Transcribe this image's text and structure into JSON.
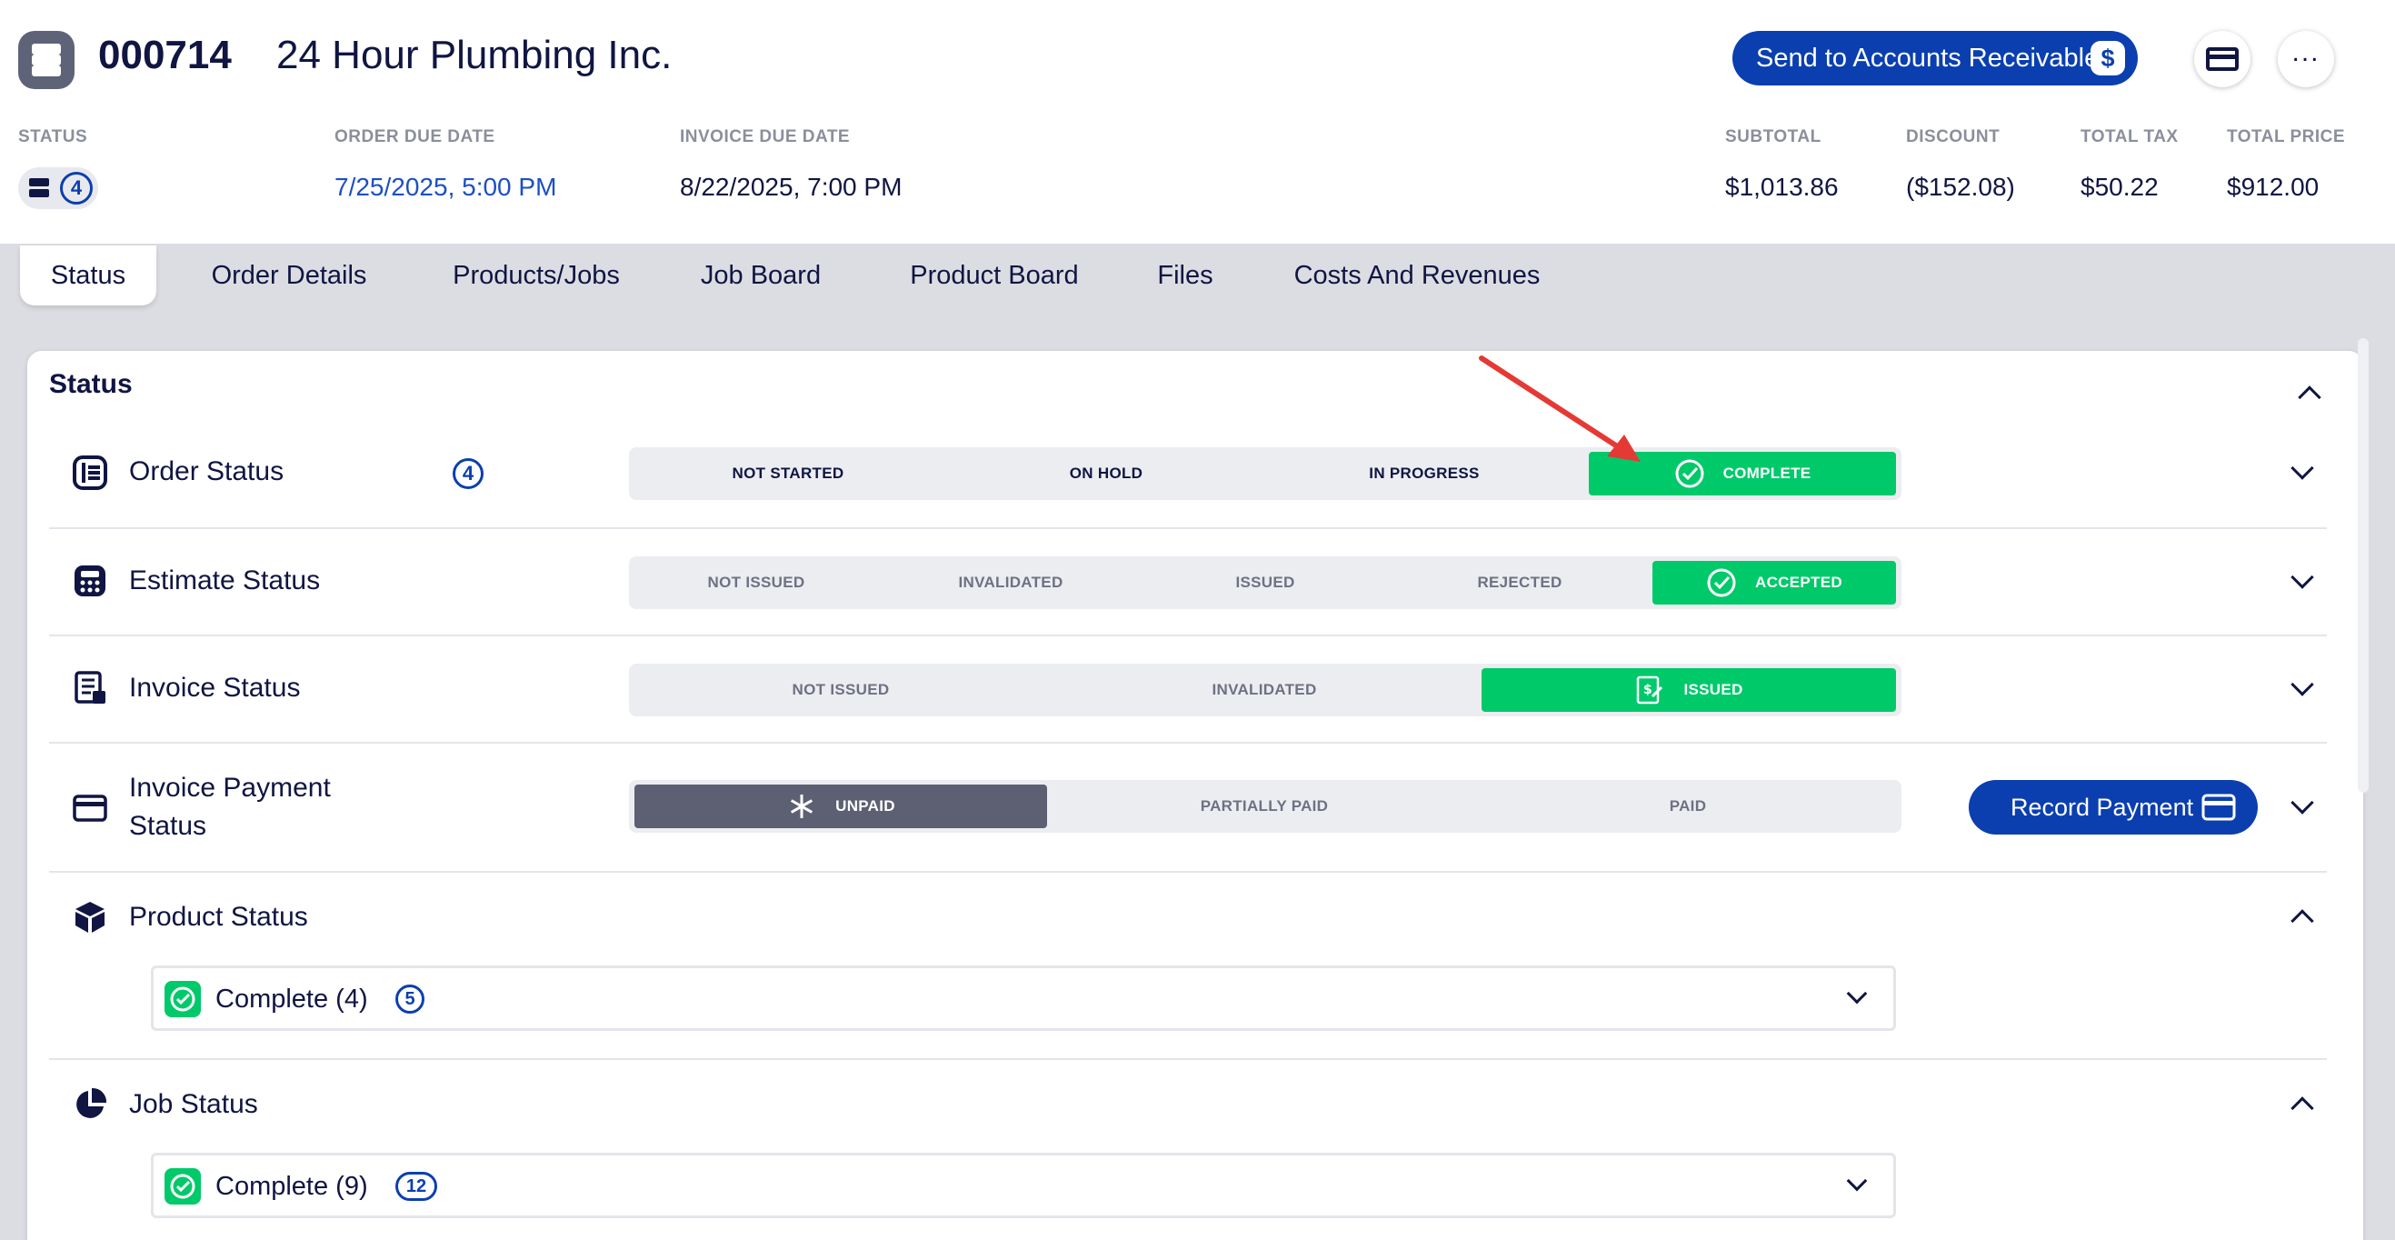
{
  "header": {
    "order_number": "000714",
    "customer_name": "24 Hour Plumbing Inc.",
    "send_ar_label": "Send to Accounts Receivable",
    "send_ar_icon": "dollar-icon",
    "status_label": "STATUS",
    "status_count": "4",
    "order_due_label": "ORDER DUE DATE",
    "order_due_value": "7/25/2025, 5:00 PM",
    "invoice_due_label": "INVOICE DUE DATE",
    "invoice_due_value": "8/22/2025, 7:00 PM",
    "subtotal_label": "SUBTOTAL",
    "subtotal_value": "$1,013.86",
    "discount_label": "DISCOUNT",
    "discount_value": "($152.08)",
    "tax_label": "TOTAL TAX",
    "tax_value": "$50.22",
    "price_label": "TOTAL PRICE",
    "price_value": "$912.00"
  },
  "tabs": [
    {
      "label": "Status",
      "active": true
    },
    {
      "label": "Order Details"
    },
    {
      "label": "Products/Jobs"
    },
    {
      "label": "Job Board"
    },
    {
      "label": "Product Board"
    },
    {
      "label": "Files"
    },
    {
      "label": "Costs And Revenues"
    }
  ],
  "panel": {
    "title": "Status",
    "order_status": {
      "label": "Order Status",
      "count": "4",
      "options": [
        "NOT STARTED",
        "ON HOLD",
        "IN PROGRESS",
        "COMPLETE"
      ],
      "selected": "COMPLETE"
    },
    "estimate_status": {
      "label": "Estimate Status",
      "options": [
        "NOT ISSUED",
        "INVALIDATED",
        "ISSUED",
        "REJECTED",
        "ACCEPTED"
      ],
      "selected": "ACCEPTED"
    },
    "invoice_status": {
      "label": "Invoice Status",
      "options": [
        "NOT ISSUED",
        "INVALIDATED",
        "ISSUED"
      ],
      "selected": "ISSUED"
    },
    "payment_status": {
      "label_line1": "Invoice Payment",
      "label_line2": "Status",
      "options": [
        "UNPAID",
        "PARTIALLY PAID",
        "PAID"
      ],
      "selected": "UNPAID",
      "record_payment_label": "Record Payment"
    },
    "product_status": {
      "label": "Product Status",
      "group_label": "Complete (4)",
      "group_count": "5"
    },
    "job_status": {
      "label": "Job Status",
      "group_label": "Complete (9)",
      "group_count": "12"
    }
  },
  "colors": {
    "brand_blue": "#0b3fb0",
    "success_green": "#00c96a",
    "unpaid_gray": "#5d6072",
    "annotation_red": "#e53935"
  }
}
